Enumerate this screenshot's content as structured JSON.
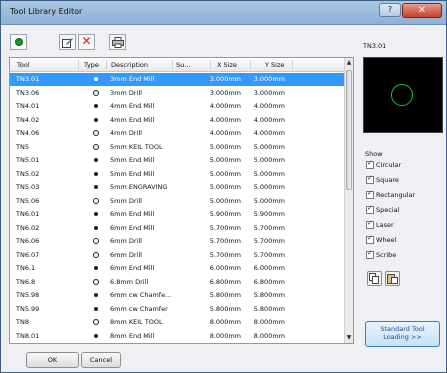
{
  "window": {
    "title": "Tool Library Editor",
    "close_label": "✕",
    "help_label": "?"
  },
  "grid": {
    "columns": {
      "tool": "Tool",
      "type": "Type",
      "description": "Description",
      "su": "Su...",
      "xsize": "X Size",
      "ysize": "Y Size"
    },
    "rows": [
      {
        "tool": "TN3.01",
        "type": "filled",
        "desc": "3mm End Mill",
        "x": "3.000mm",
        "y": "3.000mm",
        "selected": true
      },
      {
        "tool": "TN3.06",
        "type": "open",
        "desc": "3mm Drill",
        "x": "3.000mm",
        "y": "3.000mm"
      },
      {
        "tool": "TN4.01",
        "type": "filled",
        "desc": "4mm End Mill",
        "x": "4.000mm",
        "y": "4.000mm"
      },
      {
        "tool": "TN4.02",
        "type": "filled",
        "desc": "4mm End Mill",
        "x": "4.000mm",
        "y": "4.000mm"
      },
      {
        "tool": "TN4.06",
        "type": "open",
        "desc": "4mm Drill",
        "x": "4.000mm",
        "y": "4.000mm"
      },
      {
        "tool": "TN5",
        "type": "open",
        "desc": "5mm KEIL TOOL",
        "x": "5.000mm",
        "y": "5.000mm"
      },
      {
        "tool": "TN5.01",
        "type": "filled",
        "desc": "5mm End Mill",
        "x": "5.000mm",
        "y": "5.000mm"
      },
      {
        "tool": "TN5.02",
        "type": "filled",
        "desc": "5mm End Mill",
        "x": "5.000mm",
        "y": "5.000mm"
      },
      {
        "tool": "TN5.03",
        "type": "filled",
        "desc": "5mm ENGRAVING",
        "x": "5.000mm",
        "y": "5.000mm"
      },
      {
        "tool": "TN5.06",
        "type": "open",
        "desc": "5mm Drill",
        "x": "5.000mm",
        "y": "5.000mm"
      },
      {
        "tool": "TN6.01",
        "type": "filled",
        "desc": "6mm End Mill",
        "x": "5.900mm",
        "y": "5.900mm"
      },
      {
        "tool": "TN6.02",
        "type": "filled",
        "desc": "6mm End Mill",
        "x": "5.700mm",
        "y": "5.700mm"
      },
      {
        "tool": "TN6.06",
        "type": "open",
        "desc": "6mm Drill",
        "x": "5.700mm",
        "y": "5.700mm"
      },
      {
        "tool": "TN6.07",
        "type": "open",
        "desc": "6mm Drill",
        "x": "5.700mm",
        "y": "5.700mm"
      },
      {
        "tool": "TN6.1",
        "type": "filled",
        "desc": "6mm End Mill",
        "x": "6.000mm",
        "y": "6.000mm"
      },
      {
        "tool": "TN6.8",
        "type": "open",
        "desc": "6.8mm Drill",
        "x": "6.800mm",
        "y": "6.800mm"
      },
      {
        "tool": "TN5.98",
        "type": "filled",
        "desc": "6mm cw Chamfe...",
        "x": "5.800mm",
        "y": "5.800mm"
      },
      {
        "tool": "TN5.99",
        "type": "filled",
        "desc": "6mm cw Chamfer",
        "x": "5.800mm",
        "y": "5.800mm"
      },
      {
        "tool": "TN8",
        "type": "open",
        "desc": "8mm KEIL TOOL",
        "x": "8.000mm",
        "y": "8.000mm"
      },
      {
        "tool": "TN8.01",
        "type": "filled",
        "desc": "8mm End Mill",
        "x": "8.000mm",
        "y": "8.000mm"
      }
    ]
  },
  "preview": {
    "label": "TN3.01"
  },
  "show": {
    "label": "Show",
    "options": [
      "Circular",
      "Square",
      "Rectangular",
      "Special",
      "Laser",
      "Wheel",
      "Scribe"
    ]
  },
  "buttons": {
    "standard_line1": "Standard Tool",
    "standard_line2": "Loading  >>",
    "ok": "OK",
    "cancel": "Cancel"
  },
  "icons": {
    "toolbar": [
      "new-tool-icon",
      "edit-icon",
      "delete-icon",
      "print-icon"
    ],
    "small": [
      "copy-icon",
      "paste-icon"
    ]
  }
}
